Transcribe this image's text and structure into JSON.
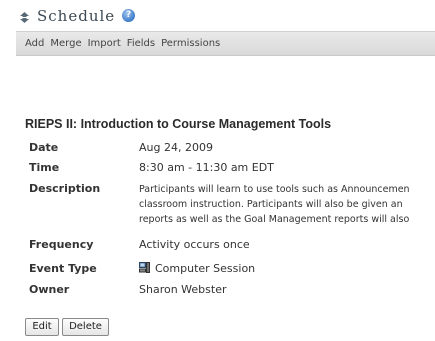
{
  "header": {
    "title": "Schedule",
    "title_icon": "arrows-icon",
    "help_icon_label": "?"
  },
  "toolbar": {
    "items": [
      "Add",
      "Merge",
      "Import",
      "Fields",
      "Permissions"
    ]
  },
  "event": {
    "title": "RIEPS II: Introduction to Course Management Tools",
    "date_label": "Date",
    "date_value": "Aug 24, 2009",
    "time_label": "Time",
    "time_value": "8:30 am - 11:30 am EDT",
    "description_label": "Description",
    "description_lines": [
      "Participants will learn to use tools such as Announcemen",
      "classroom instruction. Participants will also be given an",
      "reports as well as the Goal Management reports will also"
    ],
    "frequency_label": "Frequency",
    "frequency_value": "Activity occurs once",
    "event_type_label": "Event Type",
    "event_type_value": "Computer Session",
    "event_type_icon": "computer-session-icon",
    "owner_label": "Owner",
    "owner_value": "Sharon Webster"
  },
  "actions": {
    "edit_label": "Edit",
    "delete_label": "Delete"
  },
  "colors": {
    "title_text": "#3d4a54",
    "toolbar_bg": "#e0e0e0",
    "help_icon": "#4a86d0"
  }
}
